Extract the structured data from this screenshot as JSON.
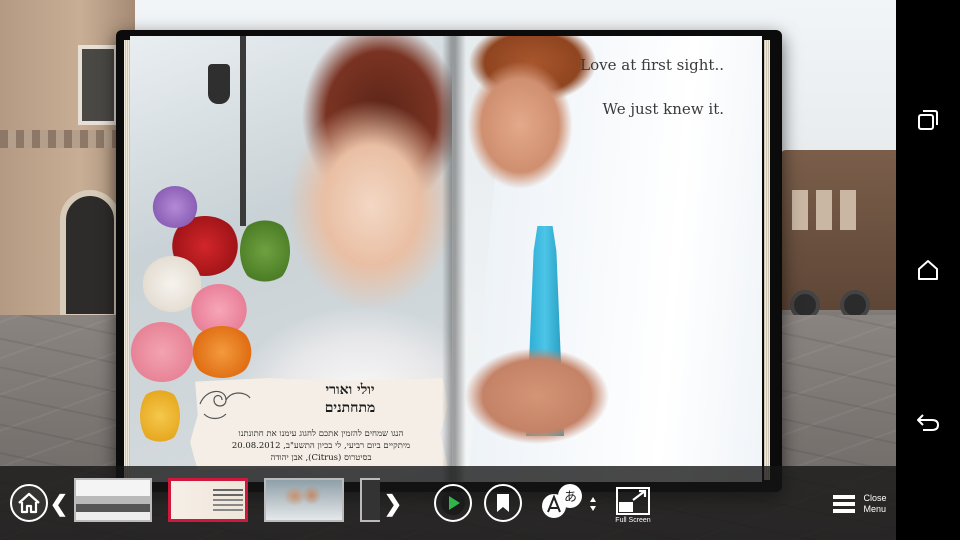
{
  "book": {
    "right_page": {
      "quote_line1": "Love at first sight..",
      "quote_line2": "We just knew it."
    },
    "caption_card": {
      "names": "יולי ואורי",
      "subtitle": "מתחתנים",
      "body_line1": "הנגו שמחים להזמין אתכם לחגוג עימנו את חתונתנו",
      "body_line2": "מיתקיים ביום רביעי, לי בכיון התשע\"ב, 20.08.2012",
      "body_line3": "בסיטרוס (Citrus), אבן יהודה"
    }
  },
  "toolbar": {
    "prev_label": "❮",
    "next_label": "❯",
    "full_screen_label": "Full Screen",
    "close_menu_label_line1": "Close",
    "close_menu_label_line2": "Menu",
    "accent_selected_thumb": "#d0183c",
    "play_color": "#2fb54a"
  },
  "icons": {
    "home": "home-icon",
    "play": "play-icon",
    "bookmark": "bookmark-icon",
    "language": "language-icon",
    "full_screen": "full-screen-icon",
    "menu": "hamburger-menu-icon",
    "recent_apps": "recent-apps-icon",
    "android_home": "android-home-icon",
    "back": "back-icon"
  }
}
